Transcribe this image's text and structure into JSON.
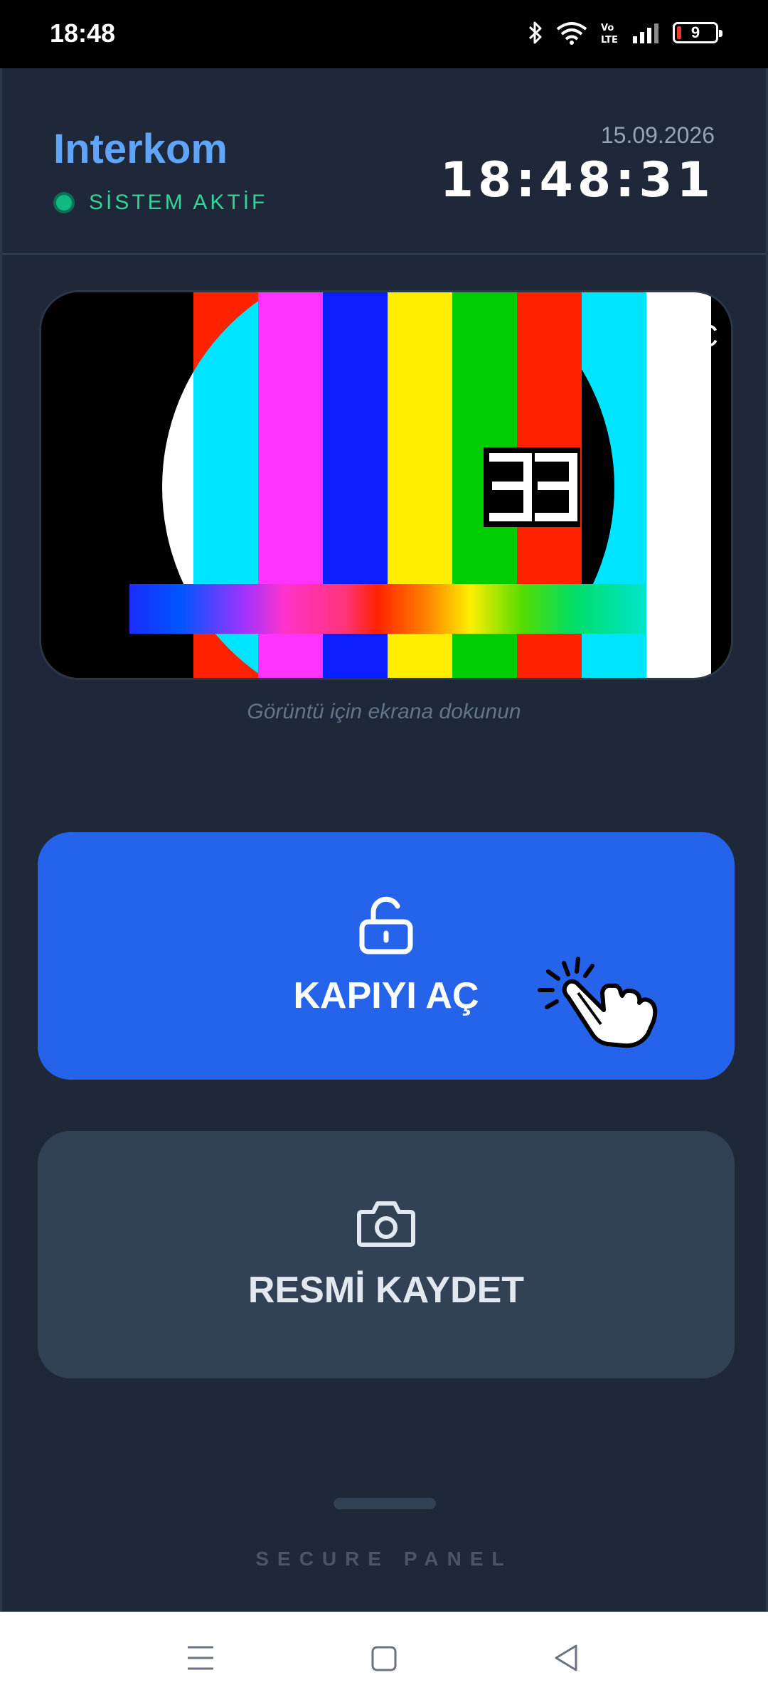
{
  "status_bar": {
    "time": "18:48",
    "battery": "9",
    "network": "VoLTE",
    "icons": [
      "bluetooth-icon",
      "wifi-icon",
      "volte-icon",
      "signal-icon",
      "battery-icon"
    ]
  },
  "header": {
    "title": "Interkom",
    "status": "SİSTEM AKTİF",
    "date": "15.09.2026",
    "clock": "18:48:31"
  },
  "camera": {
    "overlay_text": "RTC",
    "counter": "33",
    "hint": "Görüntü için ekrana dokunun"
  },
  "buttons": {
    "open_door": "KAPIYI AÇ",
    "save_image": "RESMİ KAYDET"
  },
  "footer": {
    "label": "SECURE PANEL"
  },
  "colors": {
    "background": "#1e2838",
    "accent": "#2563eb",
    "title": "#60a5fa",
    "status_active": "#10b981",
    "secondary_button": "#334155"
  },
  "navbar": {
    "icons": [
      "menu-icon",
      "home-icon",
      "back-icon"
    ]
  }
}
